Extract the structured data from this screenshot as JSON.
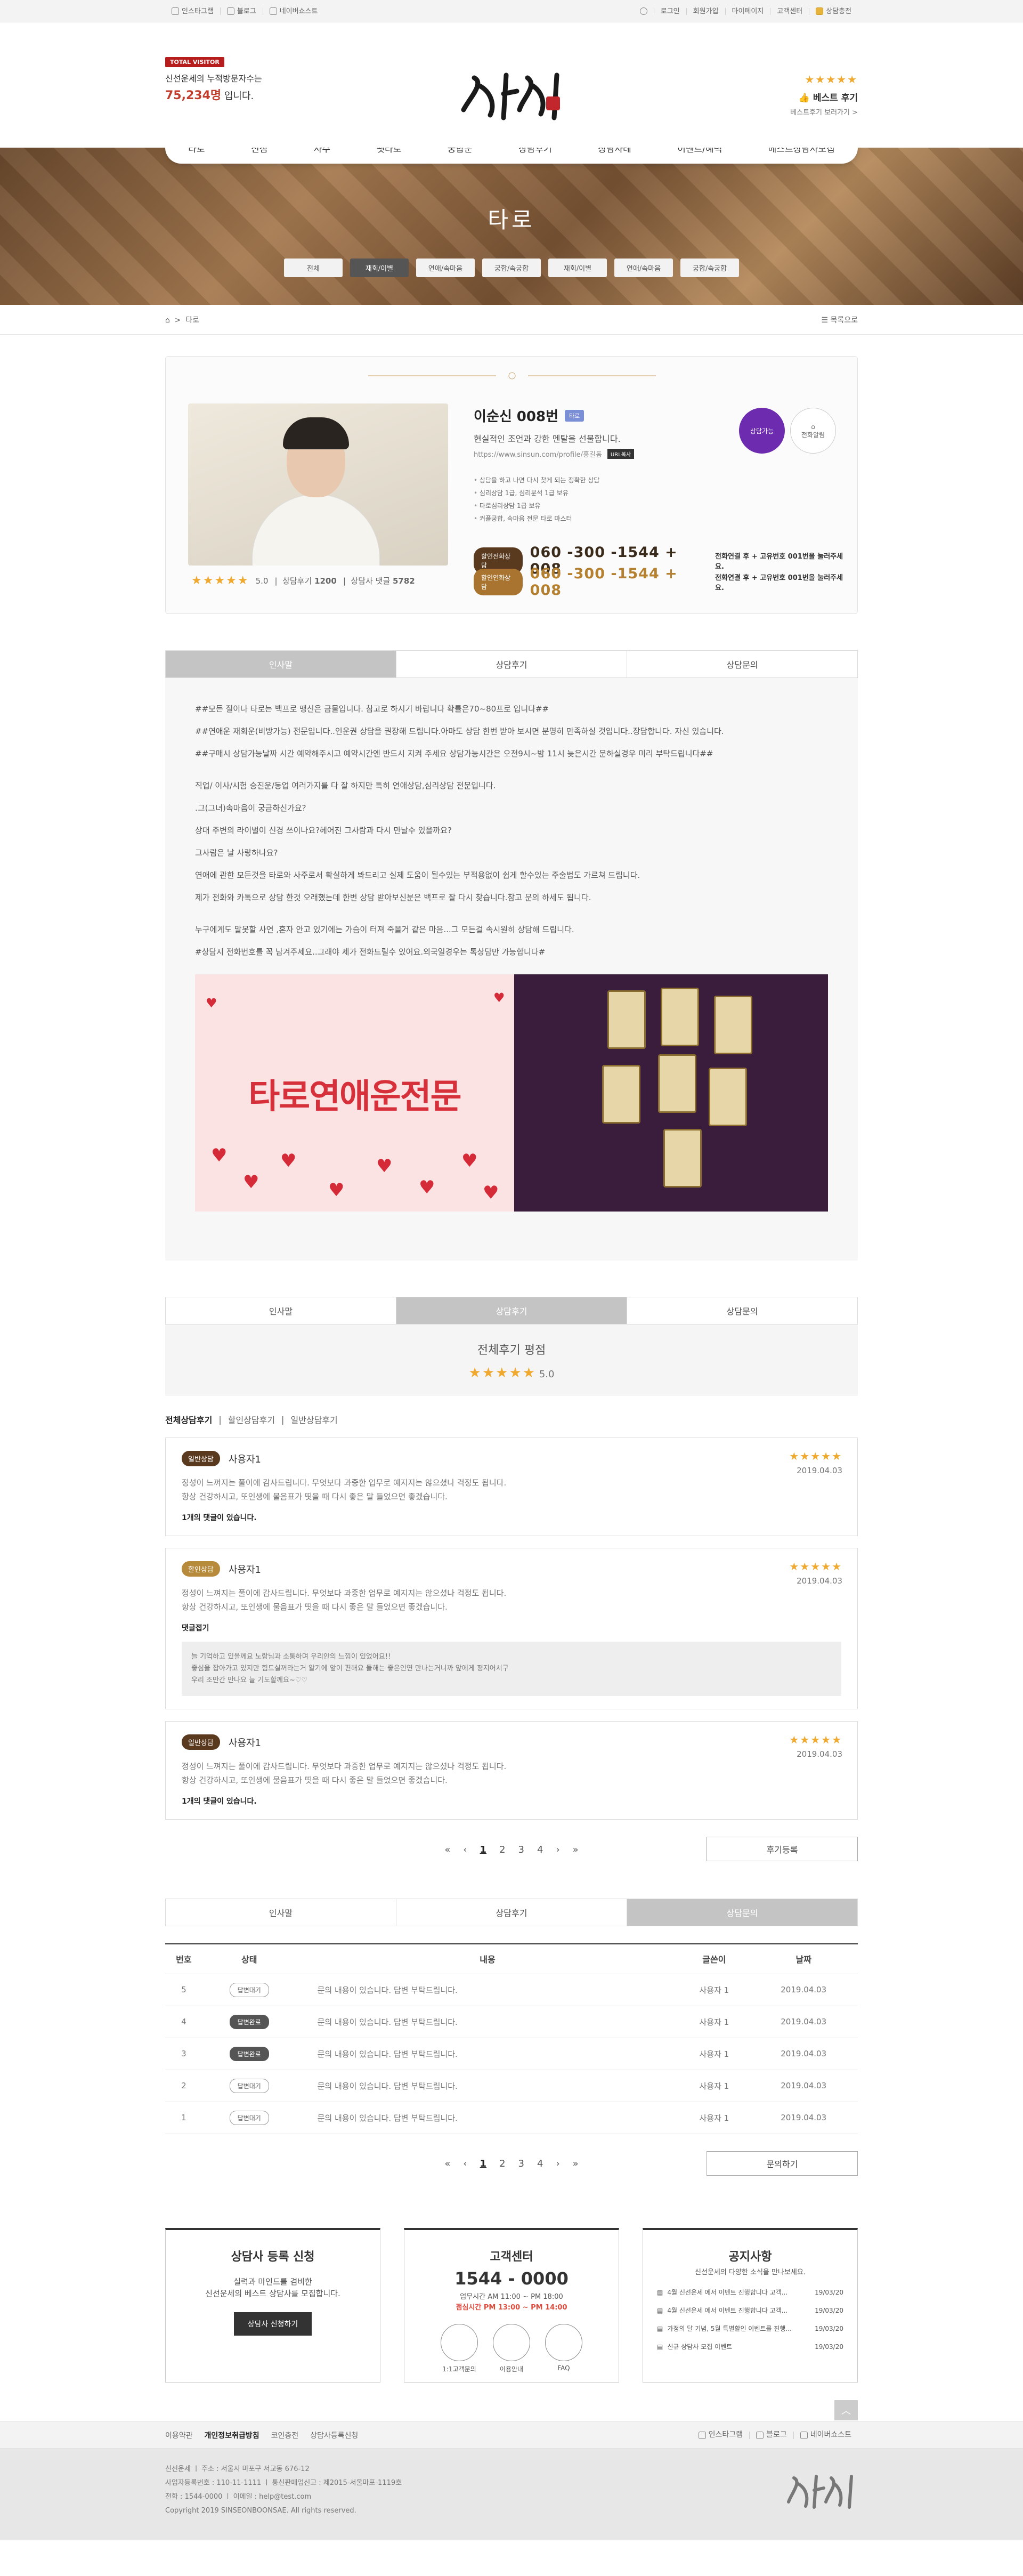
{
  "topbar": {
    "left": [
      "인스타그램",
      "블로그",
      "네이버쇼스트"
    ],
    "right": [
      "로그인",
      "회원가입",
      "마이페이지",
      "고객센터",
      "상담충전"
    ]
  },
  "header": {
    "visitor_tag": "TOTAL VISITOR",
    "visitor_line1": "신선운세의 누적방문자수는",
    "visitor_count": "75,234명",
    "visitor_suffix": " 입니다.",
    "best_stars": "★★★★★",
    "best_title": "베스트 후기",
    "best_link": "베스트후기 보러가기 >"
  },
  "nav": [
    "타로",
    "신점",
    "사주",
    "펫타로",
    "궁합운",
    "상담후기",
    "상담사례",
    "이벤트/혜택",
    "베스트상담사모집"
  ],
  "banner": {
    "title": "타로",
    "subtabs": [
      "전체",
      "재회/이별",
      "연애/속마음",
      "궁합/속궁합",
      "재회/이별",
      "연애/속마음",
      "궁합/속궁합"
    ],
    "active_subtab": 1
  },
  "breadcrumb": {
    "current": "타로",
    "list_label": "목록으로"
  },
  "counsellor": {
    "name": "이순신 008번",
    "badge": "타로",
    "intro": "현실적인 조언과 강한 멘탈을 선물합니다.",
    "url": "https://www.sinsun.com/profile/홍길동",
    "url_btn": "URL복사",
    "features": [
      "상담을 하고 나면 다시 찾게 되는 정확한 상담",
      "심리상담 1급, 심리분석 1급 보유",
      "타로심리상담 1급 보유",
      "커플궁합, 속마음 전문 타로 마스터"
    ],
    "status": "상담가능",
    "alarm": "전화알림",
    "rating": "5.0",
    "review_label": "상담후기",
    "review_count": "1200",
    "reply_label": "상담사 댓글",
    "reply_count": "5782",
    "phones": [
      {
        "label": "할인전화상담",
        "number": "060 -300 -1544 + 008",
        "note": "전화연결 후 + 고유번호 001번을 눌러주세요.",
        "color": "#5a3a1e"
      },
      {
        "label": "할인연화상담",
        "number": "060 -300 -1544 + 008",
        "note": "전화연결 후 + 고유번호 001번을 눌러주세요.",
        "color": "#a8742f"
      }
    ]
  },
  "tabs": [
    "인사말",
    "상담후기",
    "상담문의"
  ],
  "greeting": {
    "paragraphs": [
      "##모든 질이나 타로는 백프로 맹신은 금물입니다. 참고로 하시기 바랍니다 확률은70~80프로 입니다##",
      "##연애운 재회운(비방가능) 전문입니다..인운권 상담을 권장해 드립니다.아마도 상담 한번 받아 보시면 분명히 만족하실 것입니다..장담합니다. 자신 있습니다.",
      "##구매시 상담가능날짜 시간 예약해주시고 예약시간엔 반드시 지켜 주세요 상담가능시간은 오전9시~밤 11시 늦은시간 문하실경우 미리 부탁드립니다##",
      "직업/ 이사/시험 승진운/동업 여러가지를 다 잘 하지만 특히 연애상담,심리상담 전문입니다.",
      ".그(그녀)속마음이 궁금하신가요?",
      "상대 주변의 라이벌이 신경 쓰이나요?헤어진 그사람과 다시 만날수 있을까요?",
      "그사람은 날 사랑하나요?",
      " 연애에 관한 모든것을 타로와 사주로서 확실하게 봐드리고  실제 도움이 될수있는 부적용없이 쉽게 할수있는 주술법도 가르쳐 드립니다.",
      "제가 전화와 카톡으로 상담 한것 오래했는데 한번 상담 받아보신분은 백프로 잘 다시 찾습니다.참고 문의 하세도 됩니다.",
      "누구에게도 말못할 사연 ,혼자 안고 있기에는 가슴이 터져 죽을거 같은 마음...그 모든걸 속시원히 상담해 드립니다.",
      "#상담시 전화번호를 꼭 남겨주세요..그래야 제가 전화드릴수 있어요.외국일경우는 톡상담만 가능합니다#"
    ],
    "promo_text": "타로연애운전문"
  },
  "reviews": {
    "summary_title": "전체후기 평점",
    "summary_stars": "★★★★★",
    "summary_score": "5.0",
    "filters": [
      "전체상담후기",
      "할인상담후기",
      "일반상담후기"
    ],
    "items": [
      {
        "tag": "일반상담",
        "tagClass": "d",
        "user": "사용자1",
        "body1": "정성이 느껴지는 풀이에 감사드립니다. 무엇보다 과중한 업무로 예지지는 않으셨나 걱정도 됩니다.",
        "body2": "항상 건강하시고, 또인생에 물음표가 띳을 때 다시 좋은 말 들었으면 좋겠습니다.",
        "comment": "1개의 댓글이 있습니다.",
        "date": "2019.04.03"
      },
      {
        "tag": "할인상담",
        "tagClass": "g",
        "user": "사용자1",
        "body1": "정성이 느껴지는 풀이에 감사드립니다. 무엇보다 과중한 업무로 예지지는 않으셨나 걱정도 됩니다.",
        "body2": "항상 건강하시고, 또인생에 물음표가 띳을 때 다시 좋은 말 들었으면 좋겠습니다.",
        "comment": "댓글접기",
        "reply": [
          "늘 기억하고 있을께요 노랑님과 소통하며 우리안의 느낌이 있었어요!!",
          "좋심을 잡아가고 있지만 힘드실꺼라는거 알기에 앞이 편해요 들해는 좋은인연 만나는거니까 앞에게 평지어서구",
          "우리 조만간 만나요 늘 기도할께요~♡♡"
        ],
        "date": "2019.04.03"
      },
      {
        "tag": "일반상담",
        "tagClass": "d",
        "user": "사용자1",
        "body1": "정성이 느껴지는 풀이에 감사드립니다. 무엇보다 과중한 업무로 예지지는 않으셨나 걱정도 됩니다.",
        "body2": "항상 건강하시고, 또인생에 물음표가 띳을 때 다시 좋은 말 들었으면 좋겠습니다.",
        "comment": "1개의 댓글이 있습니다.",
        "date": "2019.04.03"
      }
    ],
    "pager": [
      "«",
      "‹",
      "1",
      "2",
      "3",
      "4",
      "›",
      "»"
    ],
    "write_btn": "후기등록"
  },
  "qna": {
    "headers": [
      "번호",
      "상태",
      "내용",
      "글쓴이",
      "날짜"
    ],
    "rows": [
      {
        "no": "5",
        "status": "답변대기",
        "done": false,
        "content": "문의 내용이 있습니다. 답변 부탁드립니다.",
        "writer": "사용자 1",
        "date": "2019.04.03"
      },
      {
        "no": "4",
        "status": "답변완료",
        "done": true,
        "content": "문의 내용이 있습니다. 답변 부탁드립니다.",
        "writer": "사용자 1",
        "date": "2019.04.03"
      },
      {
        "no": "3",
        "status": "답변완료",
        "done": true,
        "content": "문의 내용이 있습니다. 답변 부탁드립니다.",
        "writer": "사용자 1",
        "date": "2019.04.03"
      },
      {
        "no": "2",
        "status": "답변대기",
        "done": false,
        "content": "문의 내용이 있습니다. 답변 부탁드립니다.",
        "writer": "사용자 1",
        "date": "2019.04.03"
      },
      {
        "no": "1",
        "status": "답변대기",
        "done": false,
        "content": "문의 내용이 있습니다. 답변 부탁드립니다.",
        "writer": "사용자 1",
        "date": "2019.04.03"
      }
    ],
    "write_btn": "문의하기"
  },
  "boxes": {
    "reg_title": "상담사 등록 신청",
    "reg_text1": "실력과 마인드를 겸비한",
    "reg_text2": "신선운세의 베스트 상담사를 모집합니다.",
    "reg_btn": "상담사 신청하기",
    "cs_title": "고객센터",
    "cs_phone": "1544 - 0000",
    "cs_hours1": "업무시간 AM 11:00 ~ PM 18:00",
    "cs_hours2": "점심시간 PM 13:00 ~ PM 14:00",
    "cs_icons": [
      "1:1고객문의",
      "이용안내",
      "FAQ"
    ],
    "notice_title": "공지사항",
    "notice_sub": "신선운세의 다양한 소식을 만나보세요.",
    "notices": [
      {
        "t": "4월 신선운세 에서 이벤트 진행합니다 고객...",
        "d": "19/03/20"
      },
      {
        "t": "4월 신선운세 에서 이벤트 진행합니다 고객...",
        "d": "19/03/20"
      },
      {
        "t": "가정의 달 기념, 5월 특별할인 이벤트를 진행...",
        "d": "19/03/20"
      },
      {
        "t": "신규 상담사 모집 이벤트",
        "d": "19/03/20"
      }
    ]
  },
  "footer": {
    "links": [
      "이용약관",
      "개인정보취급방침",
      "코인충전",
      "상담사등록신청"
    ],
    "social": [
      "인스타그램",
      "블로그",
      "네이버쇼스트"
    ],
    "line1": "신선운세 ㅣ 주소 : 서울시 마포구 서교동 676-12",
    "line2": "사업자등록번호 : 110-11-1111 ㅣ 통신판매업신고 : 제2015-서울마포-1119호",
    "line3": "전화 : 1544-0000 ㅣ 이메일 : help@test.com",
    "copy": "Copyright 2019 SINSEONBOONSAE. All rights reserved."
  },
  "colors": {
    "accent": "#c03c2c",
    "brown": "#5a3a1e",
    "gold": "#b88a3c",
    "star": "#f0a92f",
    "purple": "#6d2bb0"
  }
}
